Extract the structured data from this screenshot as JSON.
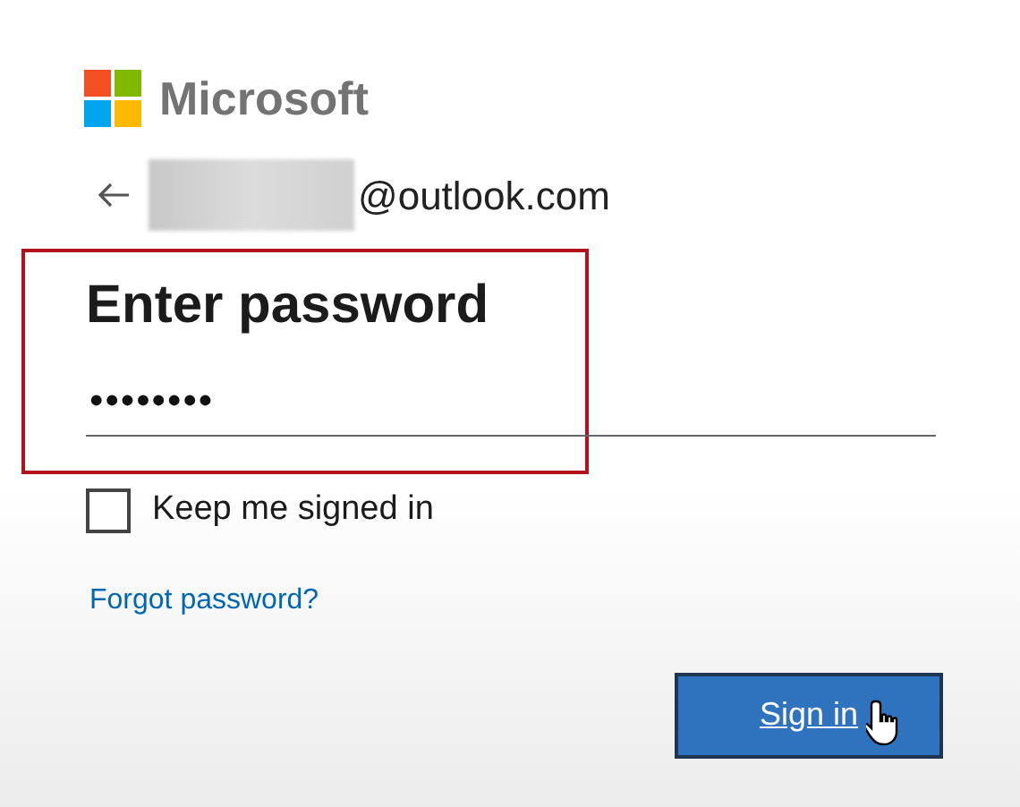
{
  "brand": {
    "name": "Microsoft"
  },
  "account": {
    "email_suffix": "@outlook.com"
  },
  "heading": "Enter password",
  "password": {
    "value": "••••••••"
  },
  "keep_signed_in": {
    "label": "Keep me signed in",
    "checked": false
  },
  "forgot_link": "Forgot password?",
  "sign_in_button": {
    "label": "Sign in"
  }
}
